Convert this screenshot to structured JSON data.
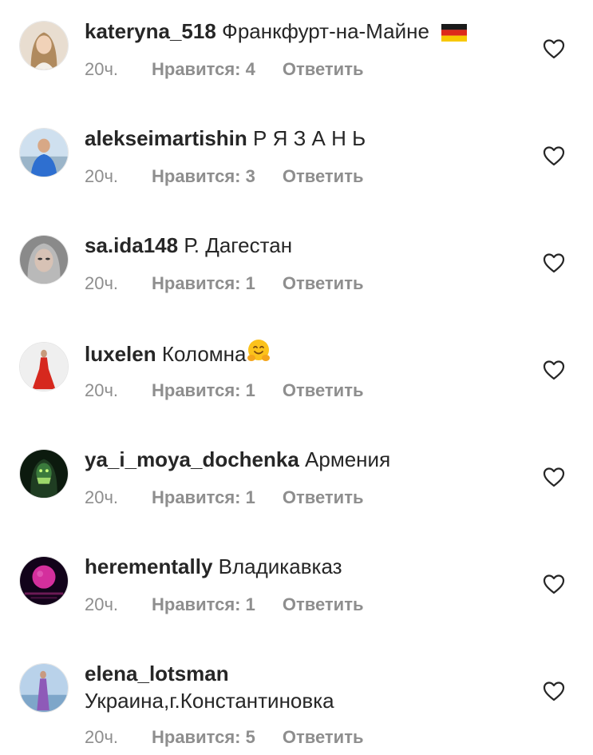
{
  "comments": [
    {
      "username": "kateryna_518",
      "text": "Франкфурт-на-Майне",
      "time": "20ч.",
      "likes": "Нравится: 4",
      "reply": "Ответить",
      "avatar_icon": "woman-portrait",
      "avatar_bg": "#d9c3a8",
      "flag": "de"
    },
    {
      "username": "alekseimartishin",
      "text": "Р Я З А Н Ь",
      "time": "20ч.",
      "likes": "Нравится: 3",
      "reply": "Ответить",
      "avatar_icon": "man-portrait",
      "avatar_bg": "#6a8db5"
    },
    {
      "username": "sa.ida148",
      "text": "Р. Дагестан",
      "time": "20ч.",
      "likes": "Нравится: 1",
      "reply": "Ответить",
      "avatar_icon": "woman-portrait",
      "avatar_bg": "#9a9a9a"
    },
    {
      "username": "luxelen",
      "text": "Коломна",
      "time": "20ч.",
      "likes": "Нравится: 1",
      "reply": "Ответить",
      "avatar_icon": "red-dress-figure",
      "avatar_bg": "#eeeeee",
      "emoji": "hugging-face"
    },
    {
      "username": "ya_i_moya_dochenka",
      "text": "Армения",
      "time": "20ч.",
      "likes": "Нравится: 1",
      "reply": "Ответить",
      "avatar_icon": "dark-masked-figure",
      "avatar_bg": "#0f2a12"
    },
    {
      "username": "herementally",
      "text": "Владикавказ",
      "time": "20ч.",
      "likes": "Нравится: 1",
      "reply": "Ответить",
      "avatar_icon": "pink-moon",
      "avatar_bg": "#14041a"
    },
    {
      "username": "elena_lotsman",
      "text": "Украина,г.Константиновка",
      "time": "20ч.",
      "likes": "Нравится: 5",
      "reply": "Ответить",
      "avatar_icon": "woman-beach-figure",
      "avatar_bg": "#a9c4e0"
    }
  ],
  "colors": {
    "primary_text": "#262626",
    "secondary_text": "#8e8e8e",
    "heart_outline": "#262626"
  },
  "icons": {
    "like": "heart-outline-icon"
  }
}
